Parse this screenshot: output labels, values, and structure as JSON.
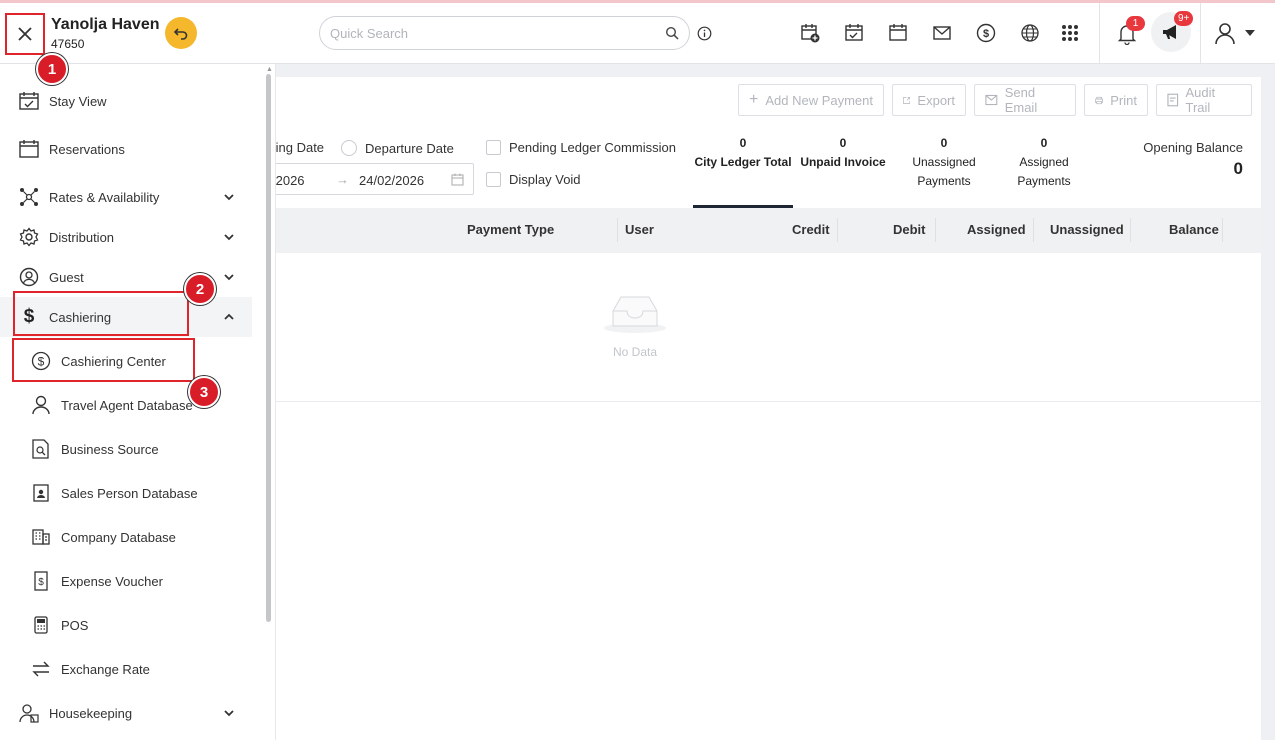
{
  "header": {
    "hotel_name": "Yanolja Haven",
    "hotel_code": "47650",
    "search_placeholder": "Quick Search",
    "notification_count": "1",
    "announcement_count": "9+"
  },
  "toolbar": {
    "add_payment": "Add New Payment",
    "export": "Export",
    "send_email": "Send Email",
    "print": "Print",
    "audit_trail": "Audit Trail"
  },
  "filters": {
    "arriving_date_partial": "ting Date",
    "departure_date": "Departure Date",
    "pending_ledger": "Pending Ledger Commission",
    "display_void": "Display Void",
    "from_date_partial": "/2026",
    "to_date": "24/02/2026"
  },
  "stats": [
    {
      "value": "0",
      "label": "City Ledger Total"
    },
    {
      "value": "0",
      "label": "Unpaid Invoice"
    },
    {
      "value": "0",
      "label_line1": "Unassigned",
      "label_line2": "Payments"
    },
    {
      "value": "0",
      "label_line1": "Assigned",
      "label_line2": "Payments"
    }
  ],
  "opening_balance": {
    "label": "Opening Balance",
    "value": "0"
  },
  "table": {
    "columns": [
      "Payment Type",
      "User",
      "Credit",
      "Debit",
      "Assigned",
      "Unassigned",
      "Balance"
    ],
    "empty_text": "No Data"
  },
  "sidebar": {
    "items": [
      {
        "label": "Stay View",
        "icon": "stay-view-icon"
      },
      {
        "label": "Reservations",
        "icon": "calendar-icon"
      },
      {
        "label": "Rates & Availability",
        "icon": "network-icon"
      },
      {
        "label": "Distribution",
        "icon": "gear-icon"
      },
      {
        "label": "Guest",
        "icon": "guest-icon"
      },
      {
        "label": "Cashiering",
        "icon": "dollar-icon"
      },
      {
        "label": "Housekeeping",
        "icon": "housekeeping-icon"
      }
    ],
    "sub_items": [
      {
        "label": "Cashiering Center",
        "icon": "dollar-circle-icon"
      },
      {
        "label": "Travel Agent Database",
        "icon": "person-icon"
      },
      {
        "label": "Business Source",
        "icon": "document-search-icon"
      },
      {
        "label": "Sales Person Database",
        "icon": "id-badge-icon"
      },
      {
        "label": "Company Database",
        "icon": "building-icon"
      },
      {
        "label": "Expense Voucher",
        "icon": "voucher-icon"
      },
      {
        "label": "POS",
        "icon": "pos-icon"
      },
      {
        "label": "Exchange Rate",
        "icon": "exchange-icon"
      }
    ]
  },
  "annotations": {
    "step1": "1",
    "step2": "2",
    "step3": "3"
  },
  "colors": {
    "accent": "#f5b72b",
    "highlight_red": "#e0242b",
    "badge_red": "#e8383e"
  }
}
